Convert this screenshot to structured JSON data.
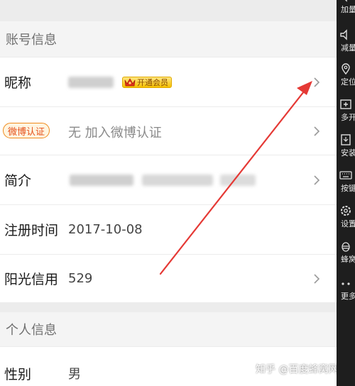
{
  "sections": {
    "account": "账号信息",
    "personal": "个人信息"
  },
  "rows": {
    "nickname": {
      "label": "昵称",
      "badge": "开通会员"
    },
    "weibo": {
      "badge": "微博认证",
      "value": "无 加入微博认证"
    },
    "intro": {
      "label": "简介"
    },
    "register": {
      "label": "注册时间",
      "value": "2017-10-08"
    },
    "credit": {
      "label": "阳光信用",
      "value": "529"
    },
    "gender": {
      "label": "性别",
      "value": "男"
    }
  },
  "sidebar": [
    {
      "icon": "volume-up-icon",
      "label": "加量"
    },
    {
      "icon": "volume-down-icon",
      "label": "减量"
    },
    {
      "icon": "location-pin-icon",
      "label": "定位"
    },
    {
      "icon": "multi-window-icon",
      "label": "多开"
    },
    {
      "icon": "apk-install-icon",
      "label": "安装"
    },
    {
      "icon": "keyboard-icon",
      "label": "按键"
    },
    {
      "icon": "gear-icon",
      "label": "设置"
    },
    {
      "icon": "bee-icon",
      "label": "蜂窝"
    },
    {
      "icon": "more-dots-icon",
      "label": "更多"
    }
  ],
  "watermark": "知乎 @百度蜂窝网络",
  "colors": {
    "arrow": "#e53935",
    "badge_gold": "#f5c000",
    "weibo_orange": "#f08a1c",
    "sidebar_bg": "#1e1e1e"
  }
}
